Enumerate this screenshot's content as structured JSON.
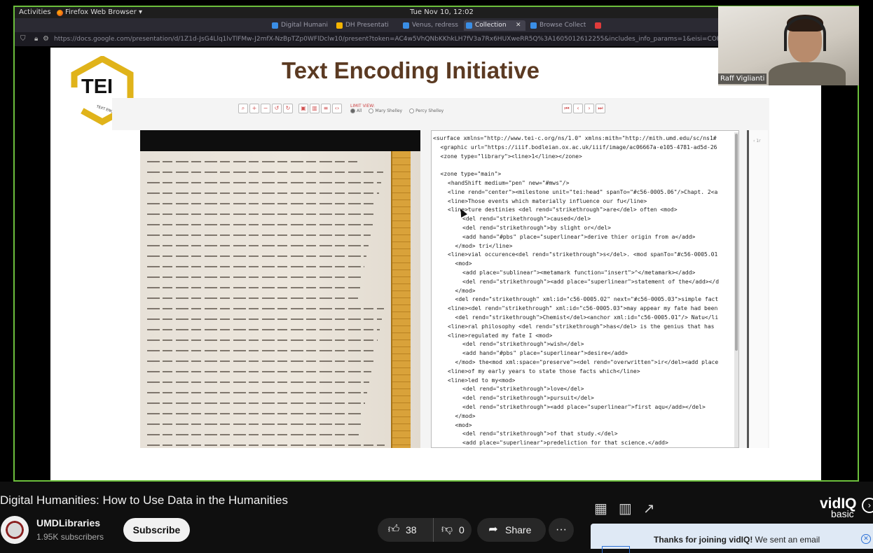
{
  "os_bar": {
    "activities": "Activities",
    "app_name": "Firefox Web Browser ▾",
    "clock": "Tue Nov 10, 12:02"
  },
  "browser": {
    "tabs": [
      {
        "label": "Digital Humani",
        "color": "#3a8ee6",
        "active": false
      },
      {
        "label": "DH Presentati",
        "color": "#f4b400",
        "active": false
      },
      {
        "label": "Venus, redresse",
        "color": "#3a8ee6",
        "active": false
      },
      {
        "label": "Collection",
        "color": "#3a8ee6",
        "active": true
      },
      {
        "label": "Browse Collect",
        "color": "#3a8ee6",
        "active": false
      },
      {
        "label": "",
        "color": "#e03b3b",
        "active": false
      }
    ],
    "url": "https://docs.google.com/presentation/d/1Z1d-JsG4Llq1lvTlFMw-J2mfX-NzBpTZp0WFlDclw10/present?token=AC4w5VhQNbKKhkLH7fV3a7Rx6HUXweRR5Q%3A1605012612255&includes_info_params=1&eisi=COHb9P"
  },
  "slide": {
    "title": "Text Encoding Initiative",
    "logo_text": "TEI",
    "logo_subtitle": "TEXT ENCODING INITIATIVE"
  },
  "viewer": {
    "toolbar_icons": [
      "zoom-reset-icon",
      "zoom-in-icon",
      "zoom-out-icon",
      "rotate-left-icon",
      "rotate-right-icon",
      "image-icon",
      "split-icon",
      "text-icon",
      "code-icon"
    ],
    "limit_view_label": "LIMIT VIEW:",
    "limit_options": [
      "All",
      "Mary Shelley",
      "Percy Shelley"
    ],
    "selected_option": "All",
    "nav_icons": [
      "first-page-icon",
      "prev-page-icon",
      "next-page-icon",
      "last-page-icon"
    ],
    "side_label": "‹  1r",
    "code_lines": [
      {
        "indent": 0,
        "text": "<surface xmlns=\"http://www.tei-c.org/ns/1.0\" xmlns:mith=\"http://mith.umd.edu/sc/ns1#"
      },
      {
        "indent": 1,
        "text": "<graphic url=\"https://iiif.bodleian.ox.ac.uk/iiif/image/ac06667a-e105-4781-ad5d-26"
      },
      {
        "indent": 1,
        "text": "<zone type=\"library\"><line>1</line></zone>"
      },
      {
        "indent": 0,
        "text": ""
      },
      {
        "indent": 1,
        "text": "<zone type=\"main\">"
      },
      {
        "indent": 2,
        "text": "<handShift medium=\"pen\" new=\"#mws\"/>"
      },
      {
        "indent": 2,
        "text": "<line rend=\"center\"><milestone unit=\"tei:head\" spanTo=\"#c56-0005.06\"/>Chapt. 2<a"
      },
      {
        "indent": 2,
        "text": "<line>Those events which materially influence our fu</line>"
      },
      {
        "indent": 2,
        "text": "<line>ture destinies <del rend=\"strikethrough\">are</del> often <mod>"
      },
      {
        "indent": 4,
        "text": "<del rend=\"strikethrough\">caused</del>"
      },
      {
        "indent": 4,
        "text": "<del rend=\"strikethrough\">by slight or</del>"
      },
      {
        "indent": 4,
        "text": "<add hand=\"#pbs\" place=\"superlinear\">derive thier origin from a</add>"
      },
      {
        "indent": 3,
        "text": "</mod> tri</line>"
      },
      {
        "indent": 2,
        "text": "<line>vial occurence<del rend=\"strikethrough\">s</del>. <mod spanTo=\"#c56-0005.01"
      },
      {
        "indent": 3,
        "text": "<mod>"
      },
      {
        "indent": 4,
        "text": "<add place=\"sublinear\"><metamark function=\"insert\">^</metamark></add>"
      },
      {
        "indent": 4,
        "text": "<del rend=\"strikethrough\"><add place=\"superlinear\">statement of the</add></d"
      },
      {
        "indent": 3,
        "text": "</mod>"
      },
      {
        "indent": 3,
        "text": "<del rend=\"strikethrough\" xml:id=\"c56-0005.02\" next=\"#c56-0005.03\">simple fact"
      },
      {
        "indent": 2,
        "text": "<line><del rend=\"strikethrough\" xml:id=\"c56-0005.03\">may appear my fate had been"
      },
      {
        "indent": 3,
        "text": "<del rend=\"strikethrough\">Chemist</del><anchor xml:id=\"c56-0005.01\"/> Natu</li"
      },
      {
        "indent": 2,
        "text": "<line>ral philosophy <del rend=\"strikethrough\">has</del> is the genius that has"
      },
      {
        "indent": 2,
        "text": "<line>regulated my fate I <mod>"
      },
      {
        "indent": 4,
        "text": "<del rend=\"strikethrough\">wish</del>"
      },
      {
        "indent": 4,
        "text": "<add hand=\"#pbs\" place=\"superlinear\">desire</add>"
      },
      {
        "indent": 3,
        "text": "</mod> the<mod xml:space=\"preserve\"><del rend=\"overwritten\">ir</del><add place"
      },
      {
        "indent": 2,
        "text": "<line>of my early years to state those facts which</line>"
      },
      {
        "indent": 2,
        "text": "<line>led to my<mod>"
      },
      {
        "indent": 4,
        "text": "<del rend=\"strikethrough\">love</del>"
      },
      {
        "indent": 4,
        "text": "<del rend=\"strikethrough\">pursuit</del>"
      },
      {
        "indent": 4,
        "text": "<del rend=\"strikethrough\"><add place=\"superlinear\">first aqu</add></del>"
      },
      {
        "indent": 3,
        "text": "</mod>"
      },
      {
        "indent": 3,
        "text": "<mod>"
      },
      {
        "indent": 4,
        "text": "<del rend=\"strikethrough\">of that study.</del>"
      },
      {
        "indent": 4,
        "text": "<add place=\"superlinear\">predeliction for that science.</add>"
      }
    ]
  },
  "webcam": {
    "participant_name": "Raff Viglianti"
  },
  "youtube": {
    "video_title": "Digital Humanities: How to Use Data in the Humanities",
    "channel_name": "UMDLibraries",
    "subscribers": "1.95K subscribers",
    "subscribe_label": "Subscribe",
    "likes": "38",
    "dislikes": "0",
    "share_label": "Share",
    "more_label": "···"
  },
  "vidiq": {
    "logo": "vidIQ",
    "plan": "basic",
    "toast_bold": "Thanks for joining vidIQ!",
    "toast_rest": " We sent an email",
    "icons": [
      "grid-icon",
      "bar-chart-icon",
      "trending-icon"
    ]
  },
  "colors": {
    "share_border": "#6cbf3c",
    "slide_title": "#5b3a22",
    "logo_hex": "#e0b31a",
    "youtube_bg": "#0f0f0f"
  }
}
